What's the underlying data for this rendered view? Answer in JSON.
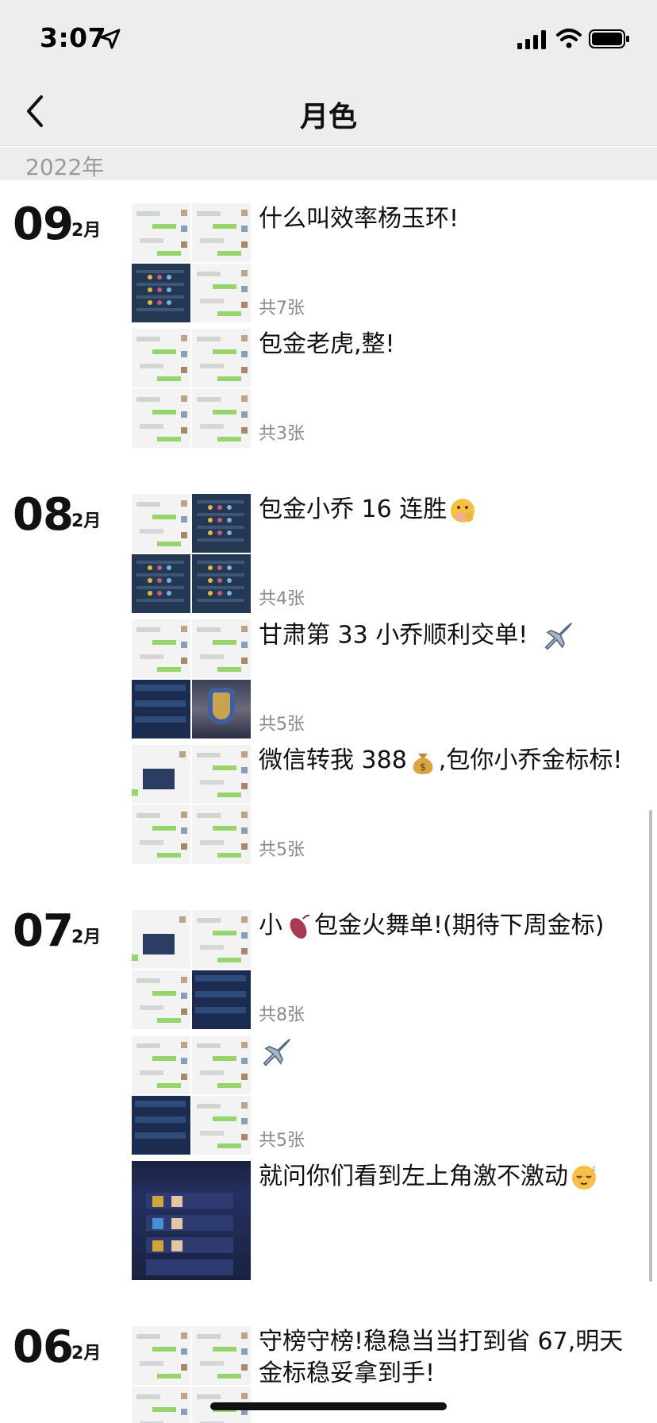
{
  "status_bar": {
    "time": "3:07"
  },
  "nav": {
    "title": "月色"
  },
  "year": "2022年",
  "groups": [
    {
      "day": "09",
      "month": "2月",
      "posts": [
        {
          "caption": "什么叫效率杨玉环!",
          "count": "共7张"
        },
        {
          "caption": "包金老虎,整!",
          "count": "共3张"
        }
      ]
    },
    {
      "day": "08",
      "month": "2月",
      "posts": [
        {
          "caption": "包金小乔 16 连胜",
          "emoji": "face-with-hand-over-mouth",
          "count": "共4张"
        },
        {
          "caption": "甘肃第 33 小乔顺利交单!",
          "emoji": "airplane",
          "count": "共5张"
        },
        {
          "caption_before": "微信转我 388",
          "emoji": "money-bag",
          "caption_after": ",包你小乔金标标!",
          "count": "共5张"
        }
      ]
    },
    {
      "day": "07",
      "month": "2月",
      "posts": [
        {
          "caption_before": "小",
          "emoji": "sweet-potato",
          "caption_after": "包金火舞单!(期待下周金标)",
          "count": "共8张"
        },
        {
          "emoji": "airplane",
          "count": "共5张"
        },
        {
          "caption": "就问你们看到左上角激不激动",
          "emoji": "sleepy-face"
        }
      ]
    },
    {
      "day": "06",
      "month": "2月",
      "posts": [
        {
          "caption": "守榜守榜!稳稳当当打到省 67,明天金标稳妥拿到手!"
        }
      ]
    }
  ],
  "colors": {
    "header_bg": "#ededed",
    "bubble_green": "#95d56b",
    "muted_text": "#8a8a8a"
  }
}
